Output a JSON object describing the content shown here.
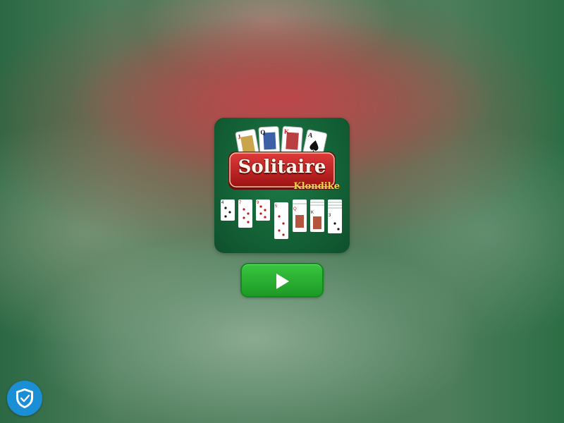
{
  "game": {
    "title": "Solitaire",
    "subtitle": "Klondike",
    "play_icon": "play-icon",
    "privacy_icon": "shield-check-icon"
  },
  "fan_cards": [
    "J",
    "Q",
    "K",
    "A"
  ],
  "tableau_ranks": [
    "4",
    "7",
    "9",
    "5",
    "Q",
    "K",
    "3"
  ],
  "colors": {
    "play_button": "#29b032",
    "shield_button": "#1a8fd6",
    "logo_bg": "#135f35",
    "banner_red": "#b81d1d",
    "subtitle_gold": "#f5d24a"
  }
}
